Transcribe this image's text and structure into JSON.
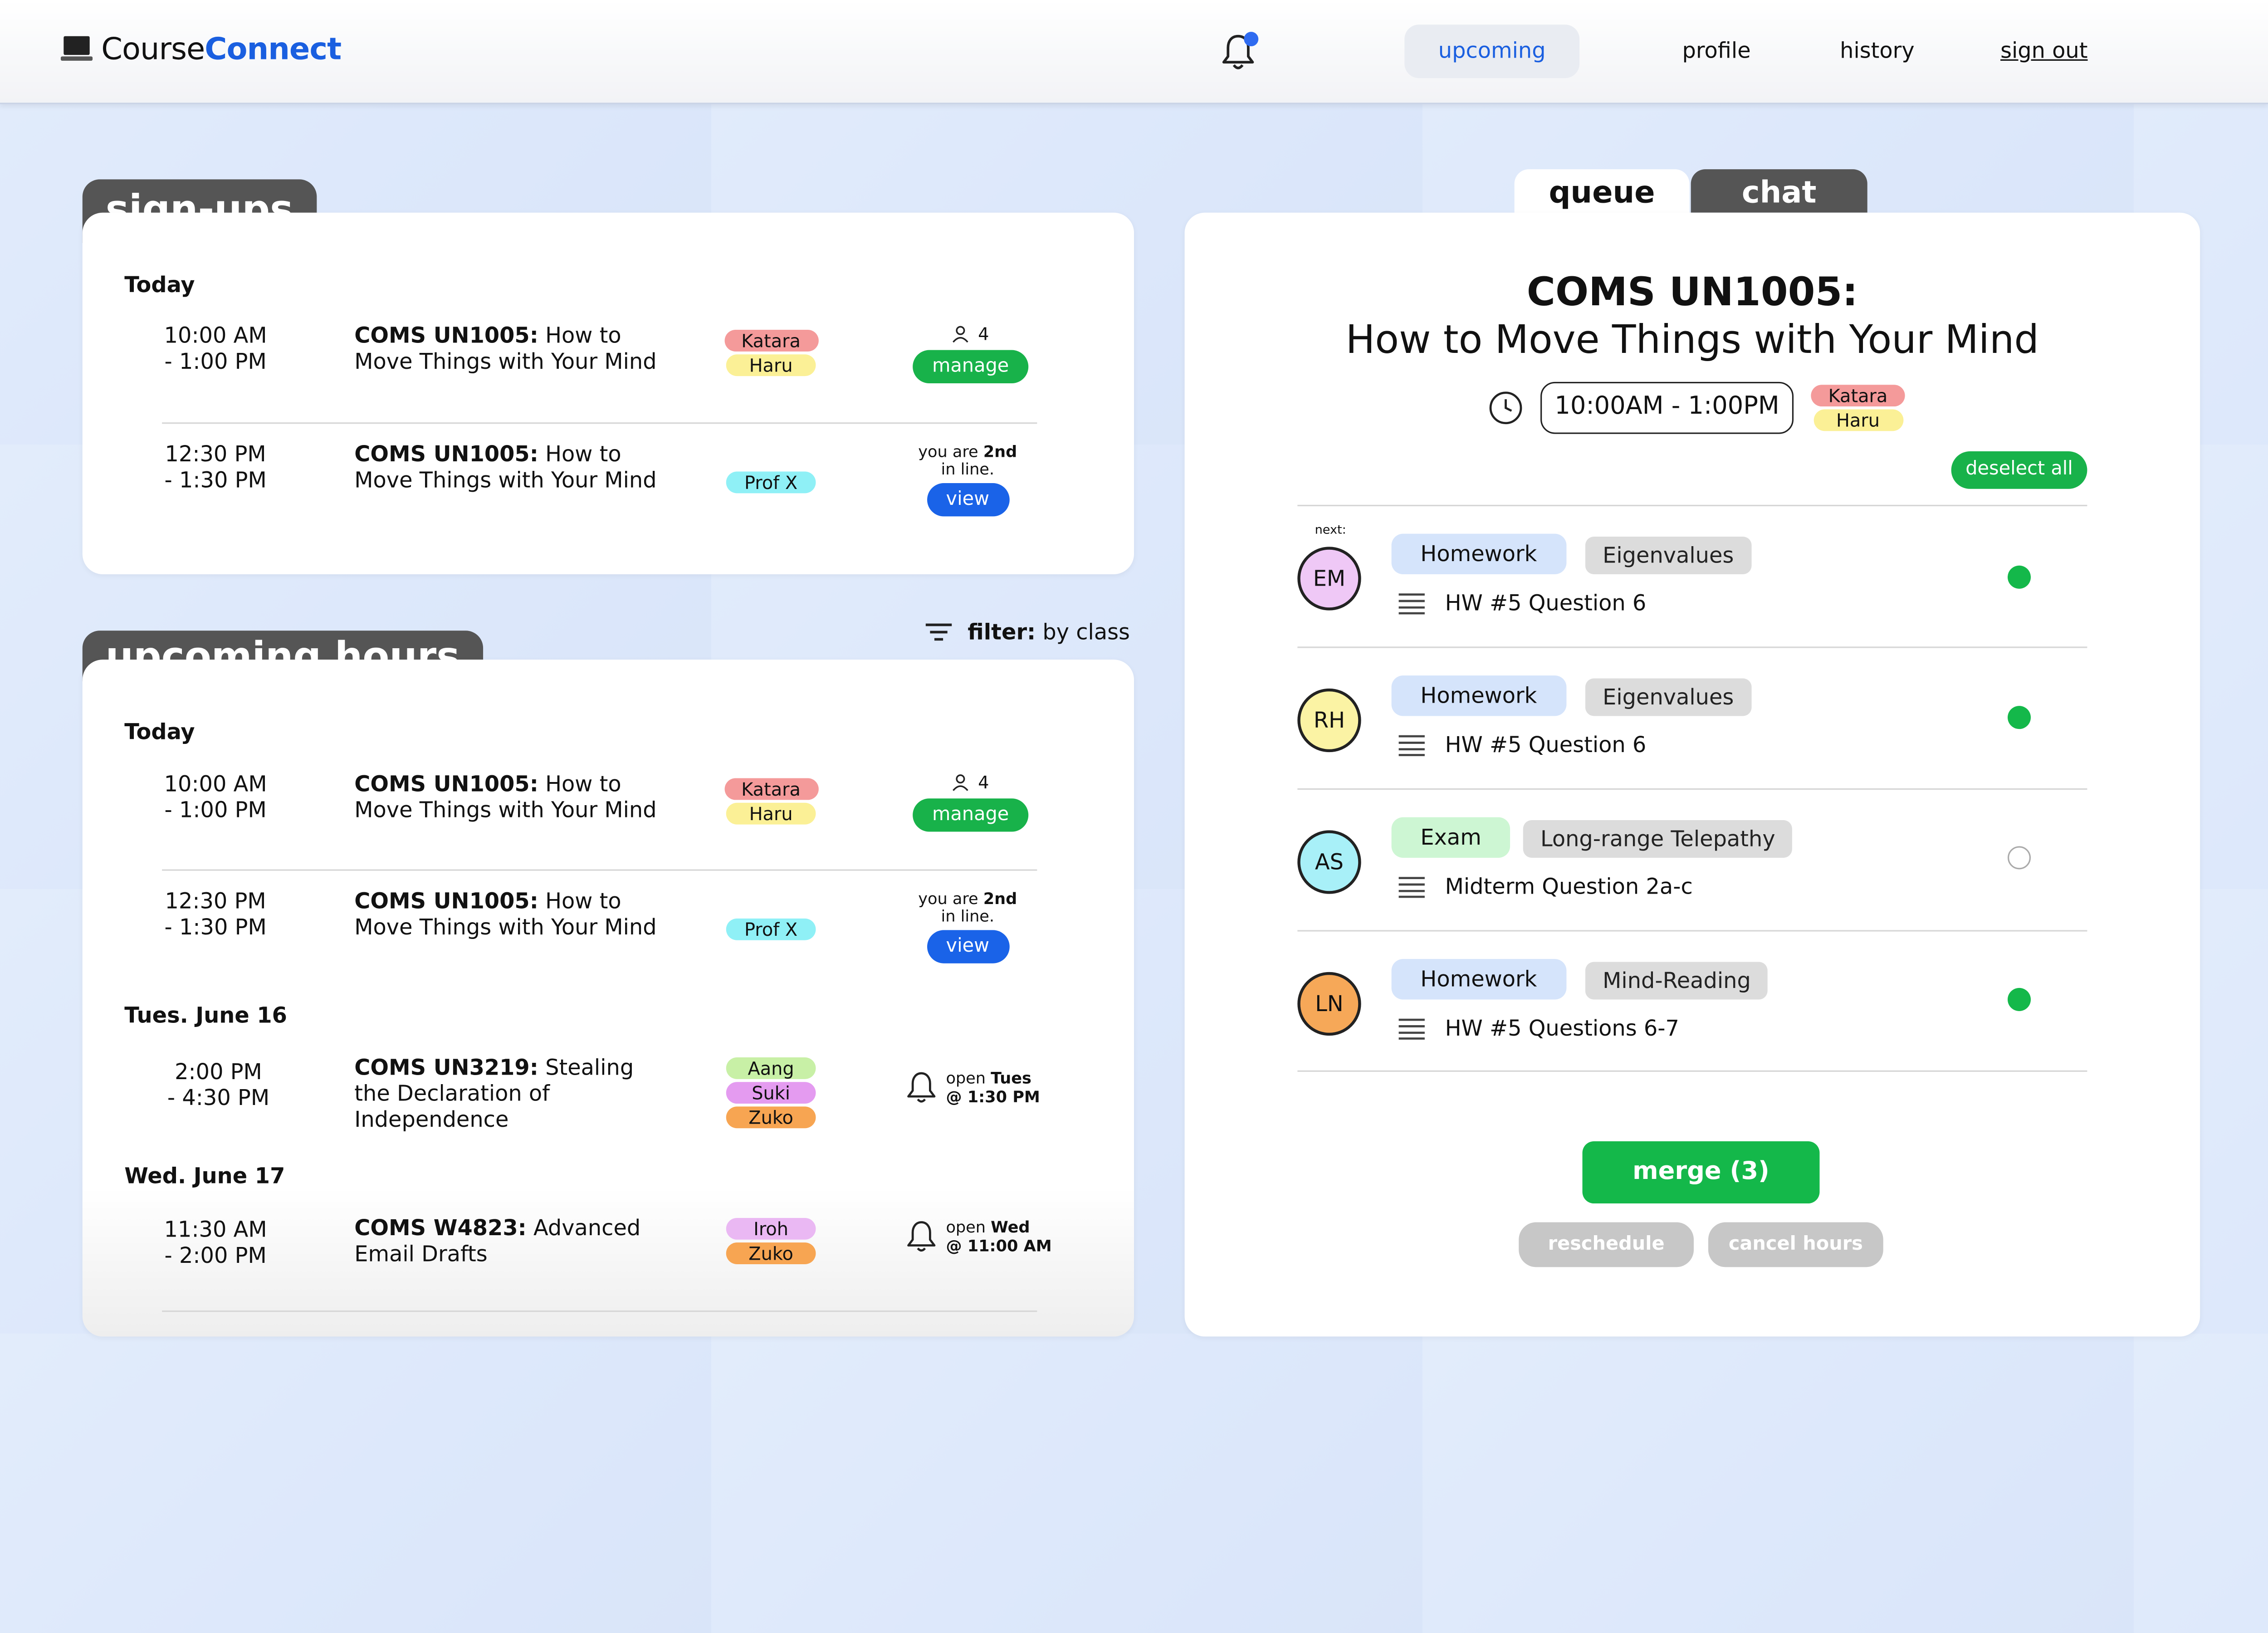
{
  "nav": {
    "logo_a": "Course",
    "logo_b": "Connect",
    "links": {
      "upcoming": "upcoming",
      "profile": "profile",
      "history": "history",
      "signout": "sign out"
    }
  },
  "signups": {
    "title": "sign-ups",
    "day": "Today",
    "rows": [
      {
        "time_start": "10:00 AM",
        "time_end": "- 1:00 PM",
        "course_code": "COMS UN1005:",
        "course_title": " How to Move Things with Your Mind",
        "people": [
          "Katara",
          "Haru"
        ],
        "count": "4",
        "action": "manage"
      },
      {
        "time_start": "12:30 PM",
        "time_end": "- 1:30 PM",
        "course_code": "COMS UN1005:",
        "course_title": " How to Move Things with Your Mind",
        "people": [
          "Prof X"
        ],
        "line_a": "you are ",
        "line_b": "2nd",
        "line_c": "in line.",
        "action": "view"
      }
    ]
  },
  "upcoming": {
    "title": "upcoming hours",
    "filter_label": "filter:",
    "filter_value": " by class",
    "days": [
      {
        "label": "Today",
        "rows": [
          {
            "time_start": "10:00 AM",
            "time_end": "- 1:00 PM",
            "course_code": "COMS UN1005:",
            "course_title": " How to Move Things with Your Mind",
            "people": [
              "Katara",
              "Haru"
            ],
            "count": "4",
            "action": "manage"
          },
          {
            "time_start": "12:30 PM",
            "time_end": "- 1:30 PM",
            "course_code": "COMS UN1005:",
            "course_title": " How to Move Things with Your Mind",
            "people": [
              "Prof X"
            ],
            "line_a": "you are ",
            "line_b": "2nd",
            "line_c": "in line.",
            "action": "view"
          }
        ]
      },
      {
        "label": "Tues. June 16",
        "rows": [
          {
            "time_start": "2:00 PM",
            "time_end": "- 4:30 PM",
            "course_code": "COMS UN3219:",
            "course_title": " Stealing the Declaration of Independence",
            "people": [
              "Aang",
              "Suki",
              "Zuko"
            ],
            "open_a": "open ",
            "open_b": "Tues",
            "open_c": "@ 1:30 PM"
          }
        ]
      },
      {
        "label": "Wed. June 17",
        "rows": [
          {
            "time_start": "11:30 AM",
            "time_end": "- 2:00 PM",
            "course_code": "COMS W4823:",
            "course_title": " Advanced Email Drafts",
            "people": [
              "Iroh",
              "Zuko"
            ],
            "open_a": "open ",
            "open_b": "Wed",
            "open_c": "@ 11:00 AM"
          }
        ]
      }
    ]
  },
  "queue_panel": {
    "tabs": {
      "queue": "queue",
      "chat": "chat"
    },
    "course_code": "COMS UN1005:",
    "course_title": "How to Move Things with Your Mind",
    "time": "10:00AM - 1:00PM",
    "people": [
      "Katara",
      "Haru"
    ],
    "deselect": "deselect all",
    "next_label": "next:",
    "items": [
      {
        "initials": "EM",
        "type": "Homework",
        "topic": "Eigenvalues",
        "desc": "HW #5 Question 6",
        "selected": true
      },
      {
        "initials": "RH",
        "type": "Homework",
        "topic": "Eigenvalues",
        "desc": "HW #5 Question 6",
        "selected": true
      },
      {
        "initials": "AS",
        "type": "Exam",
        "topic": "Long-range Telepathy",
        "desc": "Midterm Question 2a-c",
        "selected": false
      },
      {
        "initials": "LN",
        "type": "Homework",
        "topic": "Mind-Reading",
        "desc": "HW #5 Questions 6-7",
        "selected": true
      }
    ],
    "merge": "merge (3)",
    "reschedule": "reschedule",
    "cancel": "cancel hours"
  },
  "colors": {
    "accent_blue": "#1a5fe0",
    "green": "#14b84a",
    "Katara": "#f49a9a",
    "Haru": "#fbf096",
    "Prof X": "#8ff0f6",
    "Aang": "#c8f0a6",
    "Suki": "#e49bf0",
    "Zuko": "#f7a552",
    "Iroh": "#eab8f3",
    "avatar_EM": "#efc8f6",
    "avatar_RH": "#fbf3a4",
    "avatar_AS": "#a8f0f8",
    "avatar_LN": "#f6a858",
    "type_Homework": "#d5e4fb",
    "type_Exam": "#cdf6d3"
  }
}
